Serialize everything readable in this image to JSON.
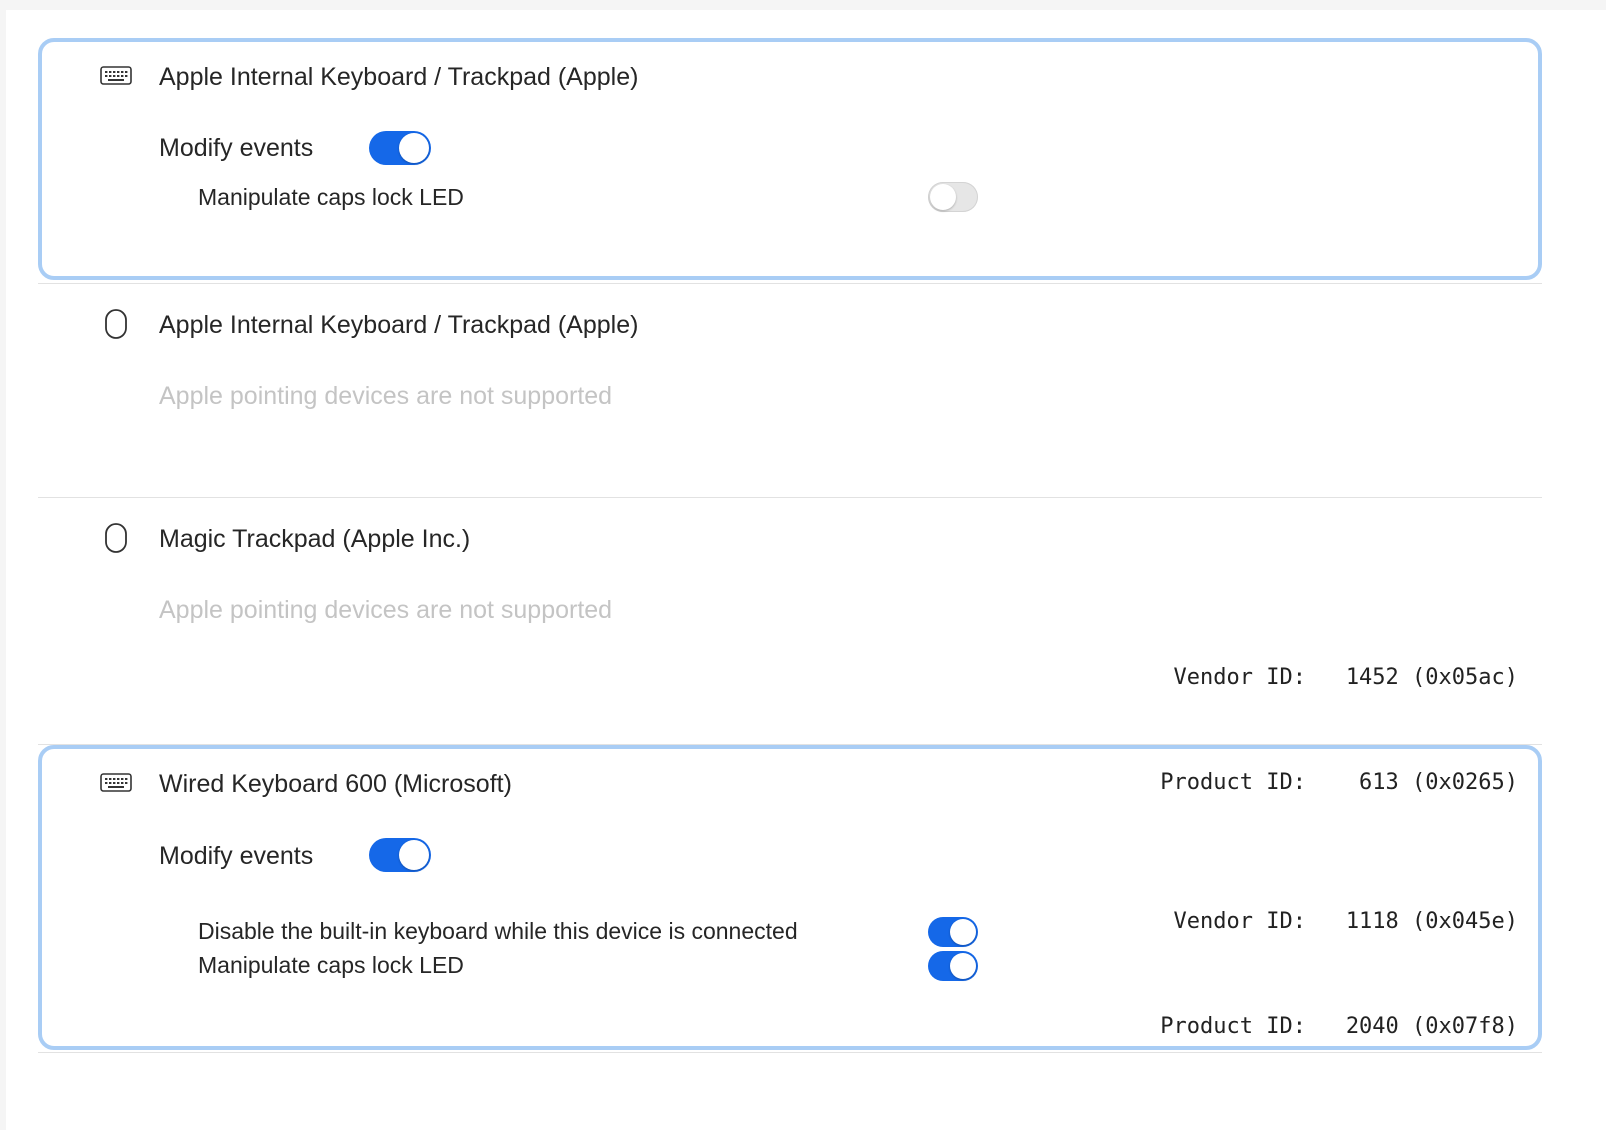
{
  "colors": {
    "accent": "#1568e8",
    "selection_border": "#a9cdf5",
    "disabled_text": "#c4c4c4"
  },
  "devices": [
    {
      "icon": "keyboard-icon",
      "name": "Apple Internal Keyboard / Trackpad (Apple)",
      "selected": true,
      "modify_events_label": "Modify events",
      "modify_events_on": true,
      "options": [
        {
          "label": "Manipulate caps lock LED",
          "on": false
        }
      ]
    },
    {
      "icon": "mouse-icon",
      "name": "Apple Internal Keyboard / Trackpad (Apple)",
      "selected": false,
      "message": "Apple pointing devices are not supported"
    },
    {
      "icon": "mouse-icon",
      "name": "Magic Trackpad (Apple Inc.)",
      "selected": false,
      "message": "Apple pointing devices are not supported",
      "vendor_id_label": "Vendor ID:",
      "vendor_id_value": "1452 (0x05ac)",
      "product_id_label": "Product ID:",
      "product_id_value": "613 (0x0265)"
    },
    {
      "icon": "keyboard-icon",
      "name": "Wired Keyboard 600 (Microsoft)",
      "selected": true,
      "modify_events_label": "Modify events",
      "modify_events_on": true,
      "vendor_id_label": "Vendor ID:",
      "vendor_id_value": "1118 (0x045e)",
      "product_id_label": "Product ID:",
      "product_id_value": "2040 (0x07f8)",
      "options": [
        {
          "label": "Disable the built-in keyboard while this device is connected",
          "on": true
        },
        {
          "label": "Manipulate caps lock LED",
          "on": true
        }
      ]
    }
  ]
}
